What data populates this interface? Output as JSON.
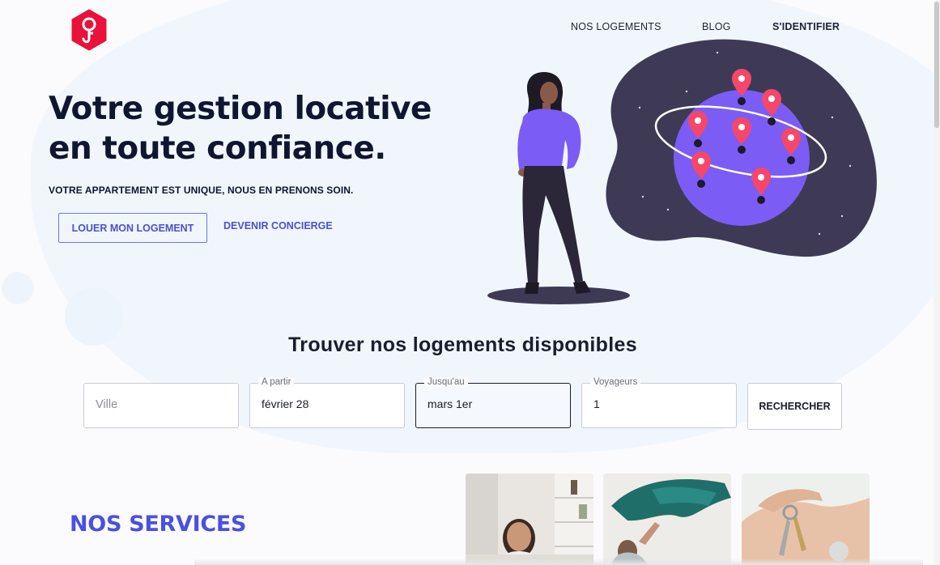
{
  "nav": {
    "logements": "NOS LOGEMENTS",
    "blog": "BLOG",
    "login": "S'IDENTIFIER"
  },
  "hero": {
    "title_line1": "Votre gestion locative",
    "title_line2": "en toute confiance.",
    "subtitle": "VOTRE APPARTEMENT EST UNIQUE, NOUS EN PRENONS SOIN.",
    "primary_button": "LOUER MON LOGEMENT",
    "secondary_link": "DEVENIR CONCIERGE"
  },
  "search": {
    "title": "Trouver nos logements disponibles",
    "ville": {
      "placeholder": "Ville",
      "value": ""
    },
    "a_partir": {
      "label": "A partir",
      "value": "février 28"
    },
    "jusquau": {
      "label": "Jusqu'au",
      "value": "mars 1er"
    },
    "voyageurs": {
      "label": "Voyageurs",
      "value": "1"
    },
    "button": "RECHERCHER"
  },
  "services": {
    "title": "NOS SERVICES"
  },
  "colors": {
    "brand_red": "#e8123a",
    "accent_blue": "#4a50e0",
    "navy": "#0e1630",
    "illustration_dark": "#3e3a55",
    "illustration_purple": "#7b5cf5",
    "pin_pink": "#f5476a"
  },
  "icons": {
    "logo": "key-pin-logo-icon"
  }
}
